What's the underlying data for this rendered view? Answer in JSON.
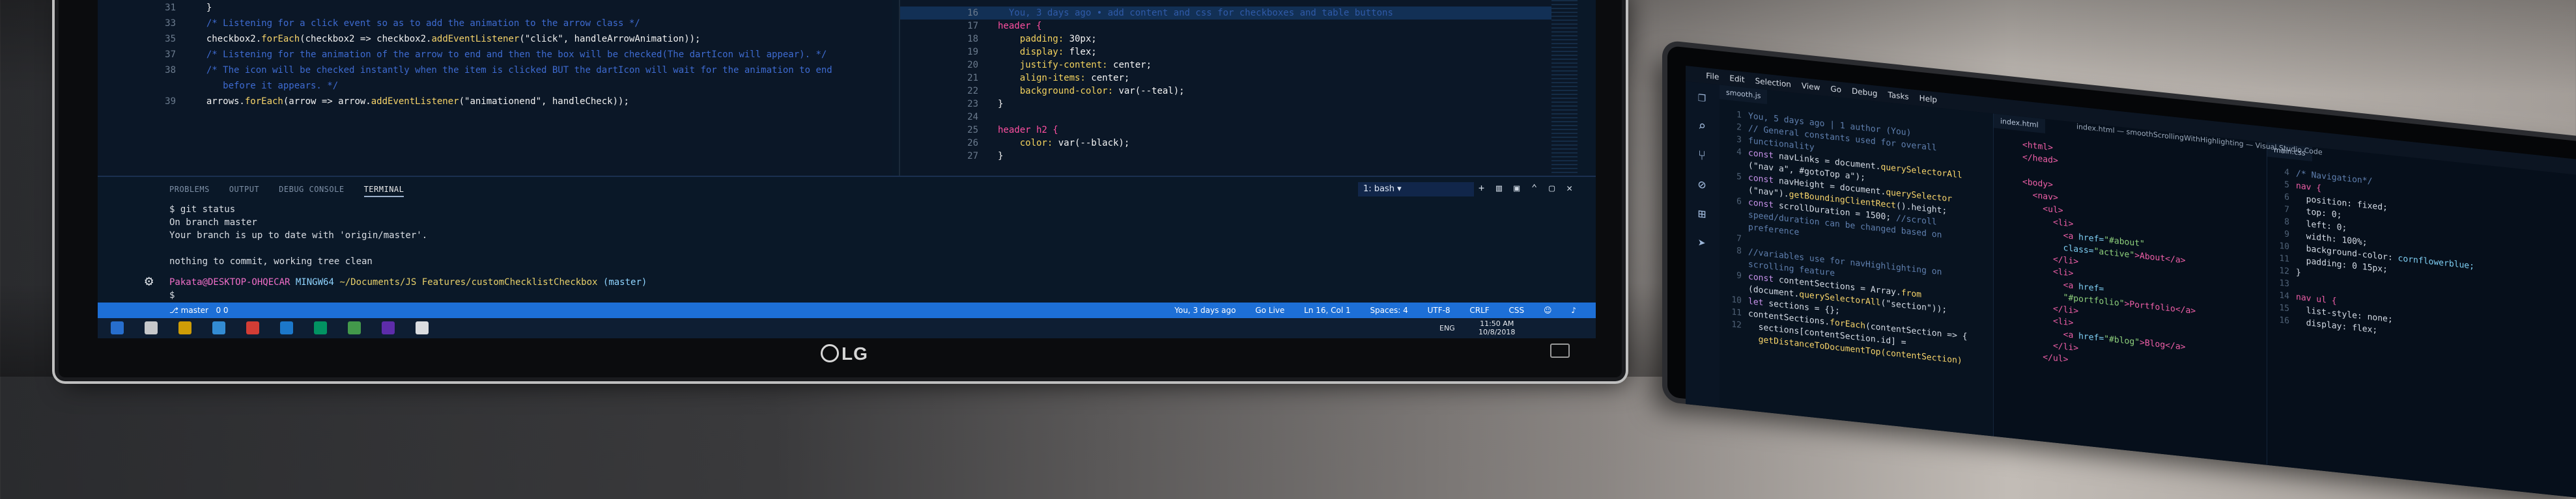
{
  "monitor": {
    "brand": "LG",
    "left_code": [
      {
        "n": "31",
        "segments": [
          {
            "t": "  }",
            "c": "c-key"
          }
        ]
      },
      {
        "n": "33",
        "segments": [
          {
            "t": "  /* Listening for a click event so as to add the animation to the arrow class */",
            "c": "c-com"
          }
        ]
      },
      {
        "n": "35",
        "segments": [
          {
            "t": "  checkbox2.",
            "c": "c-key"
          },
          {
            "t": "forEach",
            "c": "c-fn"
          },
          {
            "t": "(checkbox2 => checkbox2.",
            "c": "c-key"
          },
          {
            "t": "addEventListener",
            "c": "c-fn"
          },
          {
            "t": "(\"click\", handleArrowAnimation));",
            "c": "c-key"
          }
        ]
      },
      {
        "n": "37",
        "segments": [
          {
            "t": "  /* Listening for the animation of the arrow to end and then the box will be checked(The dartIcon will appear). */",
            "c": "c-com"
          }
        ]
      },
      {
        "n": "38",
        "segments": [
          {
            "t": "  /* The icon will be checked instantly when the item is clicked BUT the dartIcon will wait for the animation to end",
            "c": "c-com"
          }
        ]
      },
      {
        "n": "",
        "segments": [
          {
            "t": "     before it appears. */",
            "c": "c-com"
          }
        ]
      },
      {
        "n": "39",
        "segments": [
          {
            "t": "  arrows.",
            "c": "c-key"
          },
          {
            "t": "forEach",
            "c": "c-fn"
          },
          {
            "t": "(arrow => arrow.",
            "c": "c-key"
          },
          {
            "t": "addEventListener",
            "c": "c-fn"
          },
          {
            "t": "(\"animationend\", handleCheck));",
            "c": "c-key"
          }
        ]
      }
    ],
    "right_code": [
      {
        "n": "16",
        "segments": [
          {
            "t": "  You, 3 days ago • add content and css for checkboxes and table buttons",
            "c": "blame"
          }
        ]
      },
      {
        "n": "17",
        "segments": [
          {
            "t": "header {",
            "c": "c-sel"
          }
        ]
      },
      {
        "n": "18",
        "segments": [
          {
            "t": "    padding: ",
            "c": "c-prop"
          },
          {
            "t": "30px;",
            "c": "c-val"
          }
        ]
      },
      {
        "n": "19",
        "segments": [
          {
            "t": "    display: ",
            "c": "c-prop"
          },
          {
            "t": "flex;",
            "c": "c-val"
          }
        ]
      },
      {
        "n": "20",
        "segments": [
          {
            "t": "    justify-content: ",
            "c": "c-prop"
          },
          {
            "t": "center;",
            "c": "c-val"
          }
        ]
      },
      {
        "n": "21",
        "segments": [
          {
            "t": "    align-items: ",
            "c": "c-prop"
          },
          {
            "t": "center;",
            "c": "c-val"
          }
        ]
      },
      {
        "n": "22",
        "segments": [
          {
            "t": "    background-color: ",
            "c": "c-prop"
          },
          {
            "t": "var(--teal);",
            "c": "c-val"
          }
        ]
      },
      {
        "n": "23",
        "segments": [
          {
            "t": "}",
            "c": "c-key"
          }
        ]
      },
      {
        "n": "24",
        "segments": [
          {
            "t": "",
            "c": "c-key"
          }
        ]
      },
      {
        "n": "25",
        "segments": [
          {
            "t": "header h2 {",
            "c": "c-sel"
          }
        ]
      },
      {
        "n": "26",
        "segments": [
          {
            "t": "    color: ",
            "c": "c-prop"
          },
          {
            "t": "var(--black);",
            "c": "c-val"
          }
        ]
      },
      {
        "n": "27",
        "segments": [
          {
            "t": "}",
            "c": "c-key"
          }
        ]
      }
    ],
    "panel": {
      "tabs": [
        "PROBLEMS",
        "OUTPUT",
        "DEBUG CONSOLE",
        "TERMINAL"
      ],
      "active_tab": "TERMINAL",
      "terminal_selector": "1: bash",
      "terminal_lines": [
        "$ git status",
        "On branch master",
        "Your branch is up to date with 'origin/master'.",
        "",
        "nothing to commit, working tree clean"
      ],
      "prompt_user": "Pakata@DESKTOP-OHQECAR",
      "prompt_env": "MINGW64",
      "prompt_path": "~/Documents/JS Features/customChecklistCheckbox",
      "prompt_branch": "(master)",
      "prompt_symbol": "$ "
    },
    "statusbar": {
      "branch": "master",
      "problems": "0  0",
      "blame": "You, 3 days ago",
      "go_live": "Go Live",
      "position": "Ln 16, Col 1",
      "spaces": "Spaces: 4",
      "encoding": "UTF-8",
      "eol": "CRLF",
      "language": "CSS"
    },
    "taskbar": {
      "time": "11:50 AM",
      "date": "10/8/2018",
      "lang": "ENG",
      "colors": [
        "#2b7de9",
        "#e6e6e6",
        "#f0b400",
        "#3aa0f0",
        "#f44336",
        "#1e88e5",
        "#00a86b",
        "#4caf50",
        "#6b2fbf",
        "#ffffff"
      ]
    }
  },
  "laptop": {
    "menu": [
      "File",
      "Edit",
      "Selection",
      "View",
      "Go",
      "Debug",
      "Tasks",
      "Help"
    ],
    "window_title": "index.html — smoothScrollingWithHighlighting — Visual Studio Code",
    "tabs": [
      "smooth.js",
      "index.html",
      "main.css"
    ],
    "js_code": [
      {
        "n": "1",
        "segments": [
          {
            "t": "You, 5 days ago | 1 author (You)",
            "c": "cm"
          }
        ]
      },
      {
        "n": "2",
        "segments": [
          {
            "t": "// General constants used for overall",
            "c": "cm"
          }
        ]
      },
      {
        "n": "3",
        "segments": [
          {
            "t": "functionality",
            "c": "cm"
          }
        ]
      },
      {
        "n": "4",
        "segments": [
          {
            "t": "const ",
            "c": "kw"
          },
          {
            "t": "navLinks = document.",
            "c": ""
          },
          {
            "t": "querySelectorAll",
            "c": "fnc"
          }
        ]
      },
      {
        "n": "",
        "segments": [
          {
            "t": "(\"nav a\", #gotoTop a\");",
            "c": ""
          }
        ]
      },
      {
        "n": "5",
        "segments": [
          {
            "t": "const ",
            "c": "kw"
          },
          {
            "t": "navHeight = document.",
            "c": ""
          },
          {
            "t": "querySelector",
            "c": "fnc"
          }
        ]
      },
      {
        "n": "",
        "segments": [
          {
            "t": "(\"nav\").",
            "c": ""
          },
          {
            "t": "getBoundingClientRect",
            "c": "fnc"
          },
          {
            "t": "().height;",
            "c": ""
          }
        ]
      },
      {
        "n": "6",
        "segments": [
          {
            "t": "const ",
            "c": "kw"
          },
          {
            "t": "scrollDuration = 1500; ",
            "c": ""
          },
          {
            "t": "//scroll",
            "c": "cm"
          }
        ]
      },
      {
        "n": "",
        "segments": [
          {
            "t": "speed/duration can be changed based on",
            "c": "cm"
          }
        ]
      },
      {
        "n": "",
        "segments": [
          {
            "t": "preference",
            "c": "cm"
          }
        ]
      },
      {
        "n": "7",
        "segments": [
          {
            "t": "",
            "c": ""
          }
        ]
      },
      {
        "n": "8",
        "segments": [
          {
            "t": "//variables use for navHighlighting on",
            "c": "cm"
          }
        ]
      },
      {
        "n": "",
        "segments": [
          {
            "t": "scrolling feature",
            "c": "cm"
          }
        ]
      },
      {
        "n": "9",
        "segments": [
          {
            "t": "const ",
            "c": "kw"
          },
          {
            "t": "contentSections = Array.",
            "c": ""
          },
          {
            "t": "from",
            "c": "fnc"
          }
        ]
      },
      {
        "n": "",
        "segments": [
          {
            "t": "(document.",
            "c": ""
          },
          {
            "t": "querySelectorAll",
            "c": "fnc"
          },
          {
            "t": "(\"section\"));",
            "c": ""
          }
        ]
      },
      {
        "n": "10",
        "segments": [
          {
            "t": "let ",
            "c": "kw"
          },
          {
            "t": "sections = {};",
            "c": ""
          }
        ]
      },
      {
        "n": "11",
        "segments": [
          {
            "t": "contentSections.",
            "c": ""
          },
          {
            "t": "forEach",
            "c": "fnc"
          },
          {
            "t": "(contentSection => {",
            "c": ""
          }
        ]
      },
      {
        "n": "12",
        "segments": [
          {
            "t": "  sections[contentSection.id] =",
            "c": ""
          }
        ]
      },
      {
        "n": "",
        "segments": [
          {
            "t": "  getDistanceToDocumentTop(contentSection)",
            "c": "fnc"
          }
        ]
      }
    ],
    "html_code": [
      {
        "n": "",
        "segments": [
          {
            "t": "<html>",
            "c": "tag"
          }
        ]
      },
      {
        "n": "",
        "segments": [
          {
            "t": "</head>",
            "c": "tag"
          }
        ]
      },
      {
        "n": "",
        "segments": [
          {
            "t": "",
            "c": ""
          }
        ]
      },
      {
        "n": "",
        "segments": [
          {
            "t": "<body>",
            "c": "tag"
          }
        ]
      },
      {
        "n": "",
        "segments": [
          {
            "t": "  <nav>",
            "c": "tag"
          }
        ]
      },
      {
        "n": "",
        "segments": [
          {
            "t": "    <ul>",
            "c": "tag"
          }
        ]
      },
      {
        "n": "",
        "segments": [
          {
            "t": "      <li>",
            "c": "tag"
          }
        ]
      },
      {
        "n": "",
        "segments": [
          {
            "t": "        <a ",
            "c": "tag"
          },
          {
            "t": "href=",
            "c": "attr"
          },
          {
            "t": "\"#about\"",
            "c": "strv"
          }
        ]
      },
      {
        "n": "",
        "segments": [
          {
            "t": "        class=",
            "c": "attr"
          },
          {
            "t": "\"active\"",
            "c": "strv"
          },
          {
            "t": ">About</a>",
            "c": "tag"
          }
        ]
      },
      {
        "n": "",
        "segments": [
          {
            "t": "      </li>",
            "c": "tag"
          }
        ]
      },
      {
        "n": "",
        "segments": [
          {
            "t": "      <li>",
            "c": "tag"
          }
        ]
      },
      {
        "n": "",
        "segments": [
          {
            "t": "        <a ",
            "c": "tag"
          },
          {
            "t": "href=",
            "c": "attr"
          }
        ]
      },
      {
        "n": "",
        "segments": [
          {
            "t": "        \"#portfolio\"",
            "c": "strv"
          },
          {
            "t": ">Portfolio</a>",
            "c": "tag"
          }
        ]
      },
      {
        "n": "",
        "segments": [
          {
            "t": "      </li>",
            "c": "tag"
          }
        ]
      },
      {
        "n": "",
        "segments": [
          {
            "t": "      <li>",
            "c": "tag"
          }
        ]
      },
      {
        "n": "",
        "segments": [
          {
            "t": "        <a ",
            "c": "tag"
          },
          {
            "t": "href=",
            "c": "attr"
          },
          {
            "t": "\"#blog\"",
            "c": "strv"
          },
          {
            "t": ">Blog</a>",
            "c": "tag"
          }
        ]
      },
      {
        "n": "",
        "segments": [
          {
            "t": "      </li>",
            "c": "tag"
          }
        ]
      },
      {
        "n": "",
        "segments": [
          {
            "t": "    </ul>",
            "c": "tag"
          }
        ]
      }
    ],
    "css_code": [
      {
        "n": "4",
        "segments": [
          {
            "t": "/* Navigation*/",
            "c": "cm"
          }
        ]
      },
      {
        "n": "5",
        "segments": [
          {
            "t": "nav {",
            "c": "tag"
          }
        ]
      },
      {
        "n": "6",
        "segments": [
          {
            "t": "  position: fixed;",
            "c": ""
          }
        ]
      },
      {
        "n": "7",
        "segments": [
          {
            "t": "  top: 0;",
            "c": ""
          }
        ]
      },
      {
        "n": "8",
        "segments": [
          {
            "t": "  left: 0;",
            "c": ""
          }
        ]
      },
      {
        "n": "9",
        "segments": [
          {
            "t": "  width: 100%;",
            "c": ""
          }
        ]
      },
      {
        "n": "10",
        "segments": [
          {
            "t": "  background-color: ",
            "c": ""
          },
          {
            "t": "cornflowerblue;",
            "c": "attr"
          }
        ]
      },
      {
        "n": "11",
        "segments": [
          {
            "t": "  padding: 0 15px;",
            "c": ""
          }
        ]
      },
      {
        "n": "12",
        "segments": [
          {
            "t": "}",
            "c": ""
          }
        ]
      },
      {
        "n": "13",
        "segments": [
          {
            "t": "",
            "c": ""
          }
        ]
      },
      {
        "n": "14",
        "segments": [
          {
            "t": "nav ul {",
            "c": "tag"
          }
        ]
      },
      {
        "n": "15",
        "segments": [
          {
            "t": "  list-style: none;",
            "c": ""
          }
        ]
      },
      {
        "n": "16",
        "segments": [
          {
            "t": "  display: flex;",
            "c": ""
          }
        ]
      }
    ]
  }
}
